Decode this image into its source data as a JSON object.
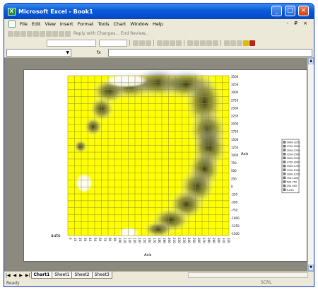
{
  "window": {
    "title": "Microsoft Excel - Book1",
    "icon": "X"
  },
  "window_buttons": {
    "minimize": "_",
    "maximize": "□",
    "close": "×"
  },
  "menu": [
    "File",
    "Edit",
    "View",
    "Insert",
    "Format",
    "Tools",
    "Chart",
    "Window",
    "Help"
  ],
  "menu_right": "- ₽ ×",
  "toolbar": {
    "review_text": "Reply with Changes... End Review..."
  },
  "formula_bar": {
    "name_box": "",
    "fx": "fx"
  },
  "chart": {
    "type": "contour",
    "bottom_left_label": "auto",
    "x_axis_title": "Axis",
    "z_axis_title": "Axis",
    "background_color": "#ffff00",
    "x_tick_labels": [
      "0",
      "10",
      "20",
      "30",
      "40",
      "50",
      "60",
      "70",
      "80",
      "90",
      "100",
      "110",
      "120",
      "130",
      "140",
      "150",
      "160",
      "170",
      "180",
      "190",
      "200",
      "210",
      "220",
      "230",
      "240",
      "250",
      "260",
      "270",
      "280",
      "290",
      "300",
      "310",
      "320"
    ],
    "y_tick_labels": [
      "3500",
      "3250",
      "3000",
      "2750",
      "2500",
      "2250",
      "2000",
      "1750",
      "1500",
      "1250",
      "1000",
      "750",
      "500",
      "250",
      "0",
      "-250",
      "-500",
      "-750",
      "-1000",
      "-1250",
      "-1500"
    ],
    "legend": [
      "3000-3250",
      "2750-3000",
      "2500-2750",
      "2250-2500",
      "2000-2250",
      "1750-2000",
      "1500-1750",
      "1250-1500",
      "1000-1250",
      "750-1000",
      "500-750",
      "250-500",
      "0-250"
    ]
  },
  "sheet_tabs": [
    "Chart1",
    "Sheet1",
    "Sheet2",
    "Sheet3"
  ],
  "active_tab": "Chart1",
  "tab_nav": [
    "|◀",
    "◀",
    "▶",
    "▶|"
  ],
  "status": {
    "left": "Ready",
    "scrl": "SCRL"
  }
}
